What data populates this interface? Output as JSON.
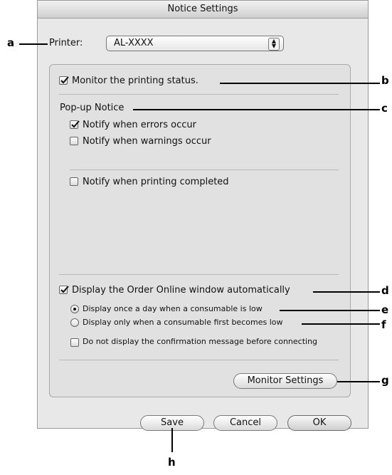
{
  "window": {
    "title": "Notice Settings"
  },
  "printer": {
    "label": "Printer:",
    "value": "AL-XXXX"
  },
  "monitor_status": {
    "label": "Monitor the printing status.",
    "checked": true
  },
  "popup_notice": {
    "heading": "Pop-up Notice",
    "errors": {
      "label": "Notify when errors occur",
      "checked": true
    },
    "warnings": {
      "label": "Notify when warnings occur",
      "checked": false
    },
    "completed": {
      "label": "Notify when printing completed",
      "checked": false
    }
  },
  "order_online": {
    "label": "Display the Order Online window automatically",
    "checked": true,
    "options": [
      {
        "label": "Display once a day when a consumable is low",
        "selected": true
      },
      {
        "label": "Display only when a consumable first becomes low",
        "selected": false
      }
    ],
    "no_confirm": {
      "label": "Do not display the confirmation message before connecting",
      "checked": false
    }
  },
  "buttons": {
    "monitor_settings": "Monitor Settings",
    "save": "Save",
    "cancel": "Cancel",
    "ok": "OK"
  },
  "callouts": [
    "a",
    "b",
    "c",
    "d",
    "e",
    "f",
    "g",
    "h"
  ]
}
